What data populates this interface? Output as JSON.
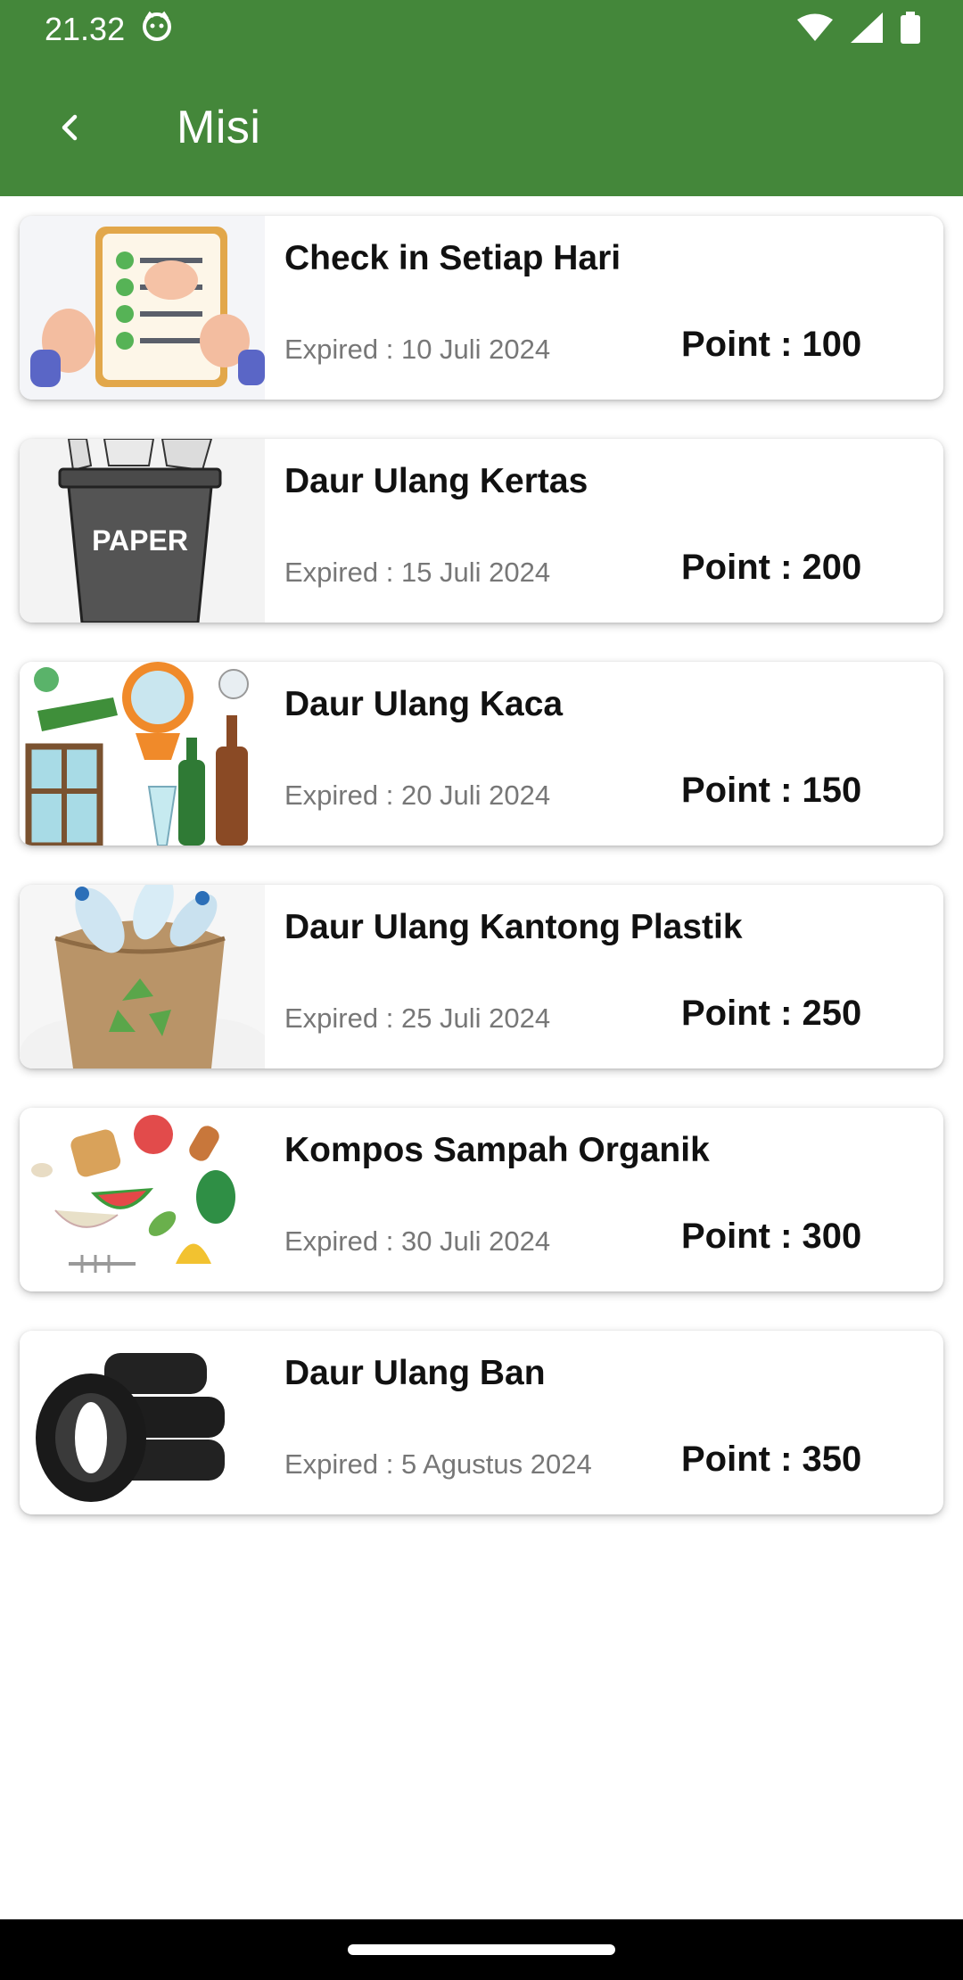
{
  "status_bar": {
    "time": "21.32",
    "icons": [
      "cat-face-notification-icon",
      "wifi-icon",
      "signal-icon",
      "battery-icon"
    ]
  },
  "app_bar": {
    "title": "Misi",
    "back_icon": "chevron-left-icon",
    "color": "#44873a"
  },
  "missions": [
    {
      "title": "Check in Setiap Hari",
      "expired": "Expired : 10 Juli 2024",
      "point": "Point : 100",
      "image": "checklist-clipboard-image"
    },
    {
      "title": "Daur Ulang Kertas",
      "expired": "Expired : 15 Juli 2024",
      "point": "Point : 200",
      "image": "paper-bin-image",
      "bin_label": "PAPER"
    },
    {
      "title": "Daur Ulang Kaca",
      "expired": "Expired : 20 Juli 2024",
      "point": "Point : 150",
      "image": "glass-items-image"
    },
    {
      "title": "Daur Ulang Kantong Plastik",
      "expired": "Expired : 25 Juli 2024",
      "point": "Point : 250",
      "image": "plastic-bottles-sack-image"
    },
    {
      "title": "Kompos Sampah Organik",
      "expired": "Expired : 30 Juli 2024",
      "point": "Point : 300",
      "image": "organic-waste-image"
    },
    {
      "title": "Daur Ulang Ban",
      "expired": "Expired : 5 Agustus 2024",
      "point": "Point : 350",
      "image": "tires-stack-image"
    }
  ]
}
